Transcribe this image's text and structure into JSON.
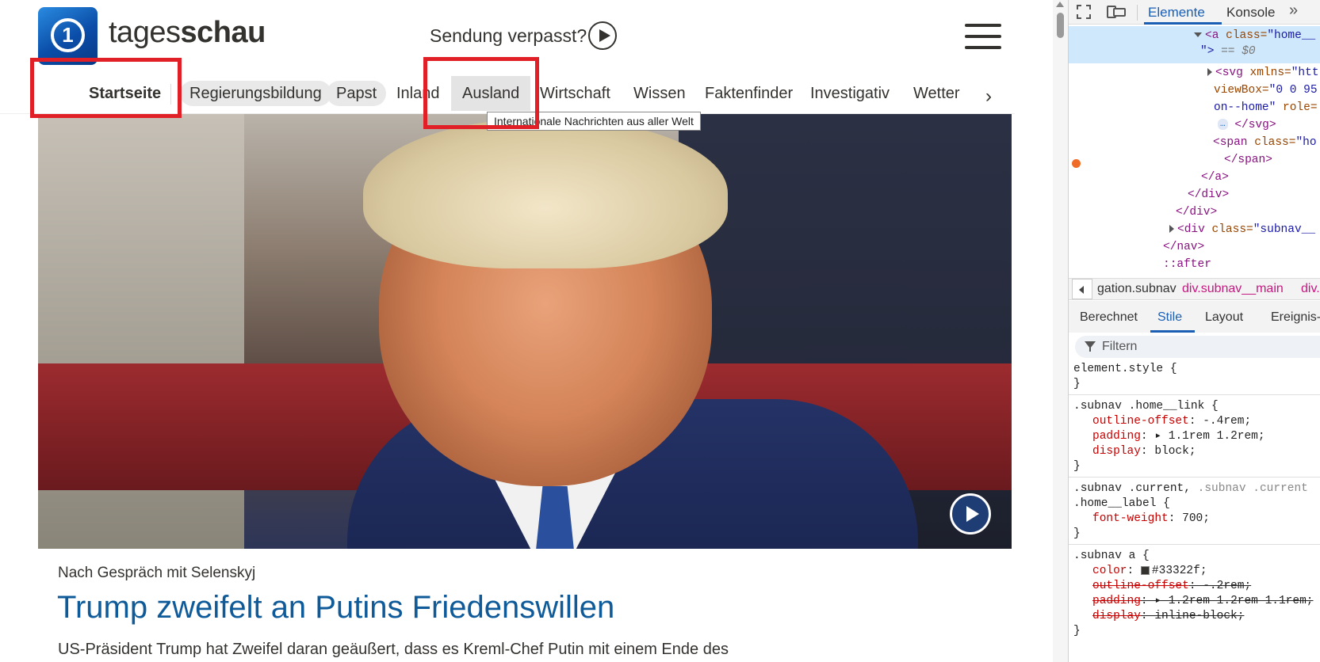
{
  "header": {
    "logo_text": "1",
    "brand_light": "tages",
    "brand_bold": "schau",
    "missed_label": "Sendung verpasst?"
  },
  "subnav": {
    "items": [
      "Startseite",
      "Regierungsbildung",
      "Papst",
      "Inland",
      "Ausland",
      "Wirtschaft",
      "Wissen",
      "Faktenfinder",
      "Investigativ",
      "Wetter"
    ],
    "next_icon": "›"
  },
  "tooltip": "Internationale Nachrichten aus aller Welt",
  "article": {
    "kicker": "Nach Gespräch mit Selenskyj",
    "headline": "Trump zweifelt an Putins Friedenswillen",
    "teaser": "US-Präsident Trump hat Zweifel daran geäußert, dass es Kreml-Chef Putin mit einem Ende des"
  },
  "colors": {
    "headline": "#0f5a99",
    "annotation": "#e01f26",
    "text": "#33322f"
  },
  "devtools": {
    "tabs": [
      "Elemente",
      "Konsole"
    ],
    "more": "»",
    "dom": [
      {
        "tag": "<a",
        "attr": "class=",
        "val": "\"home__",
        "rest": ""
      },
      {
        "tag": "",
        "attr": "",
        "val": "\">",
        "rest": " == $0"
      },
      {
        "tag": "<svg",
        "attr": " xmlns=",
        "val": "\"htt",
        "rest": ""
      },
      {
        "tag": "",
        "attr": "viewBox=",
        "val": "\"0 0 95",
        "rest": ""
      },
      {
        "tag": "",
        "attr": "",
        "val": "on--home\"",
        "rest": " role="
      },
      {
        "tag": "</svg>",
        "attr": "",
        "val": "",
        "rest": ""
      },
      {
        "tag": "<span",
        "attr": " class=",
        "val": "\"ho",
        "rest": ""
      },
      {
        "tag": "</span>",
        "attr": "",
        "val": "",
        "rest": ""
      },
      {
        "tag": "</a>",
        "attr": "",
        "val": "",
        "rest": ""
      },
      {
        "tag": "</div>",
        "attr": "",
        "val": "",
        "rest": ""
      },
      {
        "tag": "</div>",
        "attr": "",
        "val": "",
        "rest": ""
      },
      {
        "tag": "<div",
        "attr": " class=",
        "val": "\"subnav__",
        "rest": ""
      },
      {
        "tag": "</nav>",
        "attr": "",
        "val": "",
        "rest": ""
      },
      {
        "tag": "::after",
        "attr": "",
        "val": "",
        "rest": ""
      }
    ],
    "ellipsis": "…",
    "breadcrumbs": [
      "gation.subnav",
      "div.subnav__main",
      "div."
    ],
    "pane_tabs": [
      "Berechnet",
      "Stile",
      "Layout",
      "Ereignis-"
    ],
    "filter_placeholder": "Filtern",
    "styles": {
      "r1_sel": "element.style {",
      "close": "}",
      "r2_sel": ".subnav .home__link {",
      "r2_p1_name": "outline-offset",
      "r2_p1_val": ": -.4rem;",
      "r2_p2_name": "padding",
      "r2_p2_val": ": ▸ 1.1rem 1.2rem;",
      "r2_p3_name": "display",
      "r2_p3_val": ": block;",
      "r3_sel_a": ".subnav .current,",
      "r3_sel_b": " .subnav .current",
      "r3_sel_c": ".home__label {",
      "r3_p1_name": "font-weight",
      "r3_p1_val": ": 700;",
      "r4_sel": ".subnav a {",
      "r4_p1_name": "color",
      "r4_p1_val": "#33322f;",
      "r4_p2_name": "outline-offset",
      "r4_p2_val": ": -.2rem;",
      "r4_p3_name": "padding",
      "r4_p3_val": ": ▸ 1.2rem 1.2rem 1.1rem;",
      "r4_p4_name": "display",
      "r4_p4_val": ": inline-block;"
    }
  }
}
